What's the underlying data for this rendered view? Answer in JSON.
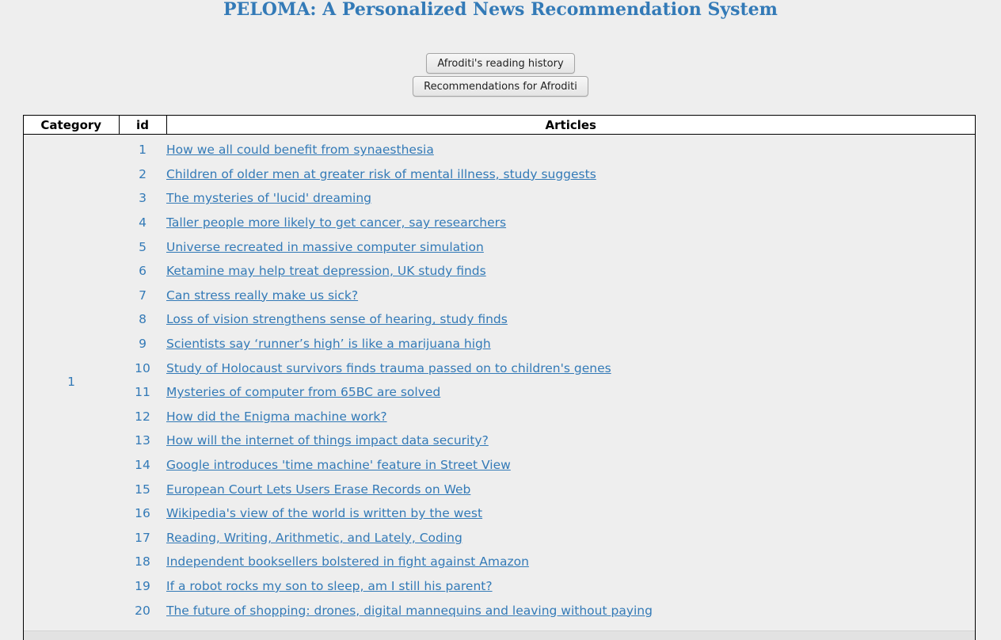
{
  "page_title": "PELOMA: A Personalized News Recommendation System",
  "buttons": {
    "history": "Afroditi's reading history",
    "recommendations": "Recommendations for Afroditi"
  },
  "table": {
    "headers": {
      "category": "Category",
      "id": "id",
      "articles": "Articles"
    },
    "category_value": "1",
    "rows": [
      {
        "id": "1",
        "title": "How we all could benefit from synaesthesia"
      },
      {
        "id": "2",
        "title": "Children of older men at greater risk of mental illness, study suggests"
      },
      {
        "id": "3",
        "title": "The mysteries of 'lucid' dreaming"
      },
      {
        "id": "4",
        "title": "Taller people more likely to get cancer, say researchers"
      },
      {
        "id": "5",
        "title": "Universe recreated in massive computer simulation"
      },
      {
        "id": "6",
        "title": "Ketamine may help treat depression, UK study finds"
      },
      {
        "id": "7",
        "title": "Can stress really make us sick?"
      },
      {
        "id": "8",
        "title": "Loss of vision strengthens sense of hearing, study finds"
      },
      {
        "id": "9",
        "title": "Scientists say ‘runner’s high’ is like a marijuana high"
      },
      {
        "id": "10",
        "title": "Study of Holocaust survivors finds trauma passed on to children's genes"
      },
      {
        "id": "11",
        "title": "Mysteries of computer from 65BC are solved"
      },
      {
        "id": "12",
        "title": "How did the Enigma machine work?"
      },
      {
        "id": "13",
        "title": "How will the internet of things impact data security?"
      },
      {
        "id": "14",
        "title": "Google introduces 'time machine' feature in Street View"
      },
      {
        "id": "15",
        "title": "European Court Lets Users Erase Records on Web"
      },
      {
        "id": "16",
        "title": "Wikipedia's view of the world is written by the west"
      },
      {
        "id": "17",
        "title": "Reading, Writing, Arithmetic, and Lately, Coding"
      },
      {
        "id": "18",
        "title": "Independent booksellers bolstered in fight against Amazon"
      },
      {
        "id": "19",
        "title": "If a robot rocks my son to sleep, am I still his parent?"
      },
      {
        "id": "20",
        "title": "The future of shopping: drones, digital mannequins and leaving without paying"
      }
    ]
  }
}
